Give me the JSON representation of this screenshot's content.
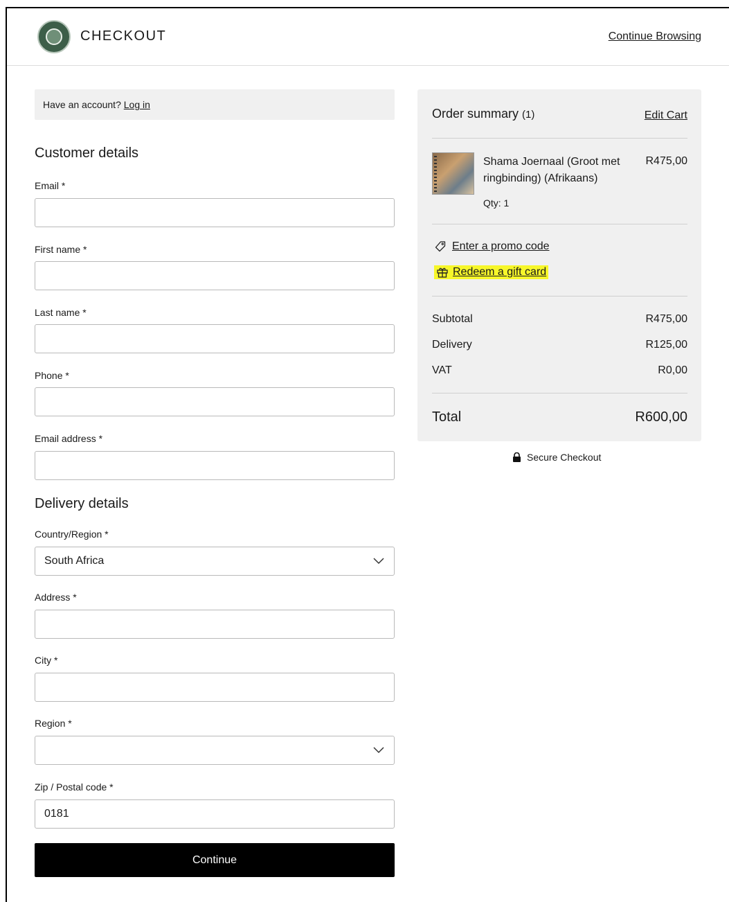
{
  "header": {
    "brand": "CHECKOUT",
    "continue_browsing": "Continue Browsing"
  },
  "account": {
    "prompt": "Have an account? ",
    "login": "Log in"
  },
  "customer": {
    "title": "Customer details",
    "email_label": "Email *",
    "email_value": "",
    "first_name_label": "First name *",
    "first_name_value": "",
    "last_name_label": "Last name *",
    "last_name_value": "",
    "phone_label": "Phone *",
    "phone_value": "",
    "email_address_label": "Email address *",
    "email_address_value": ""
  },
  "delivery": {
    "title": "Delivery details",
    "country_label": "Country/Region *",
    "country_value": "South Africa",
    "address_label": "Address *",
    "address_value": "",
    "city_label": "City *",
    "city_value": "",
    "region_label": "Region *",
    "region_value": "",
    "zip_label": "Zip / Postal code *",
    "zip_value": "0181"
  },
  "continue_label": "Continue",
  "summary": {
    "title": "Order summary",
    "count": "(1)",
    "edit_cart": "Edit Cart",
    "item": {
      "name": "Shama Joernaal (Groot met ringbinding) (Afrikaans)",
      "price": "R475,00",
      "qty": "Qty: 1"
    },
    "promo": "Enter a promo code",
    "gift": "Redeem a gift card",
    "subtotal_label": "Subtotal",
    "subtotal_value": "R475,00",
    "delivery_label": "Delivery",
    "delivery_value": "R125,00",
    "vat_label": "VAT",
    "vat_value": "R0,00",
    "total_label": "Total",
    "total_value": "R600,00"
  },
  "secure_label": "Secure Checkout",
  "colors": {
    "button_bg": "#000000",
    "panel_bg": "#f0f0f0",
    "highlight": "#f7f72a"
  }
}
